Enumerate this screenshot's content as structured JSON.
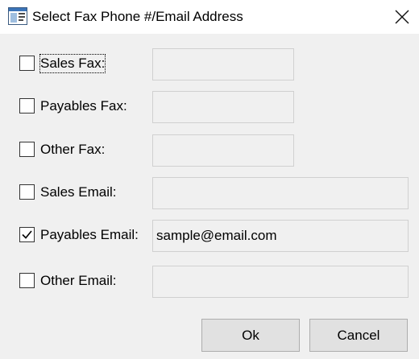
{
  "window": {
    "title": "Select Fax Phone #/Email Address",
    "app_icon": "dialog-window-icon",
    "close_icon": "close-icon"
  },
  "rows": [
    {
      "label": "Sales Fax:",
      "checked": false,
      "value": "",
      "field_size": "short",
      "focused": true
    },
    {
      "label": "Payables Fax:",
      "checked": false,
      "value": "",
      "field_size": "short"
    },
    {
      "label": "Other Fax:",
      "checked": false,
      "value": "",
      "field_size": "short"
    },
    {
      "label": "Sales Email:",
      "checked": false,
      "value": "",
      "field_size": "long"
    },
    {
      "label": "Payables Email:",
      "checked": true,
      "value": "sample@email.com",
      "field_size": "long"
    },
    {
      "label": "Other Email:",
      "checked": false,
      "value": "",
      "field_size": "long"
    }
  ],
  "buttons": {
    "ok_label": "Ok",
    "cancel_label": "Cancel"
  },
  "colors": {
    "window_bg": "#f0f0f0",
    "titlebar_bg": "#ffffff",
    "button_bg": "#e1e1e1"
  }
}
